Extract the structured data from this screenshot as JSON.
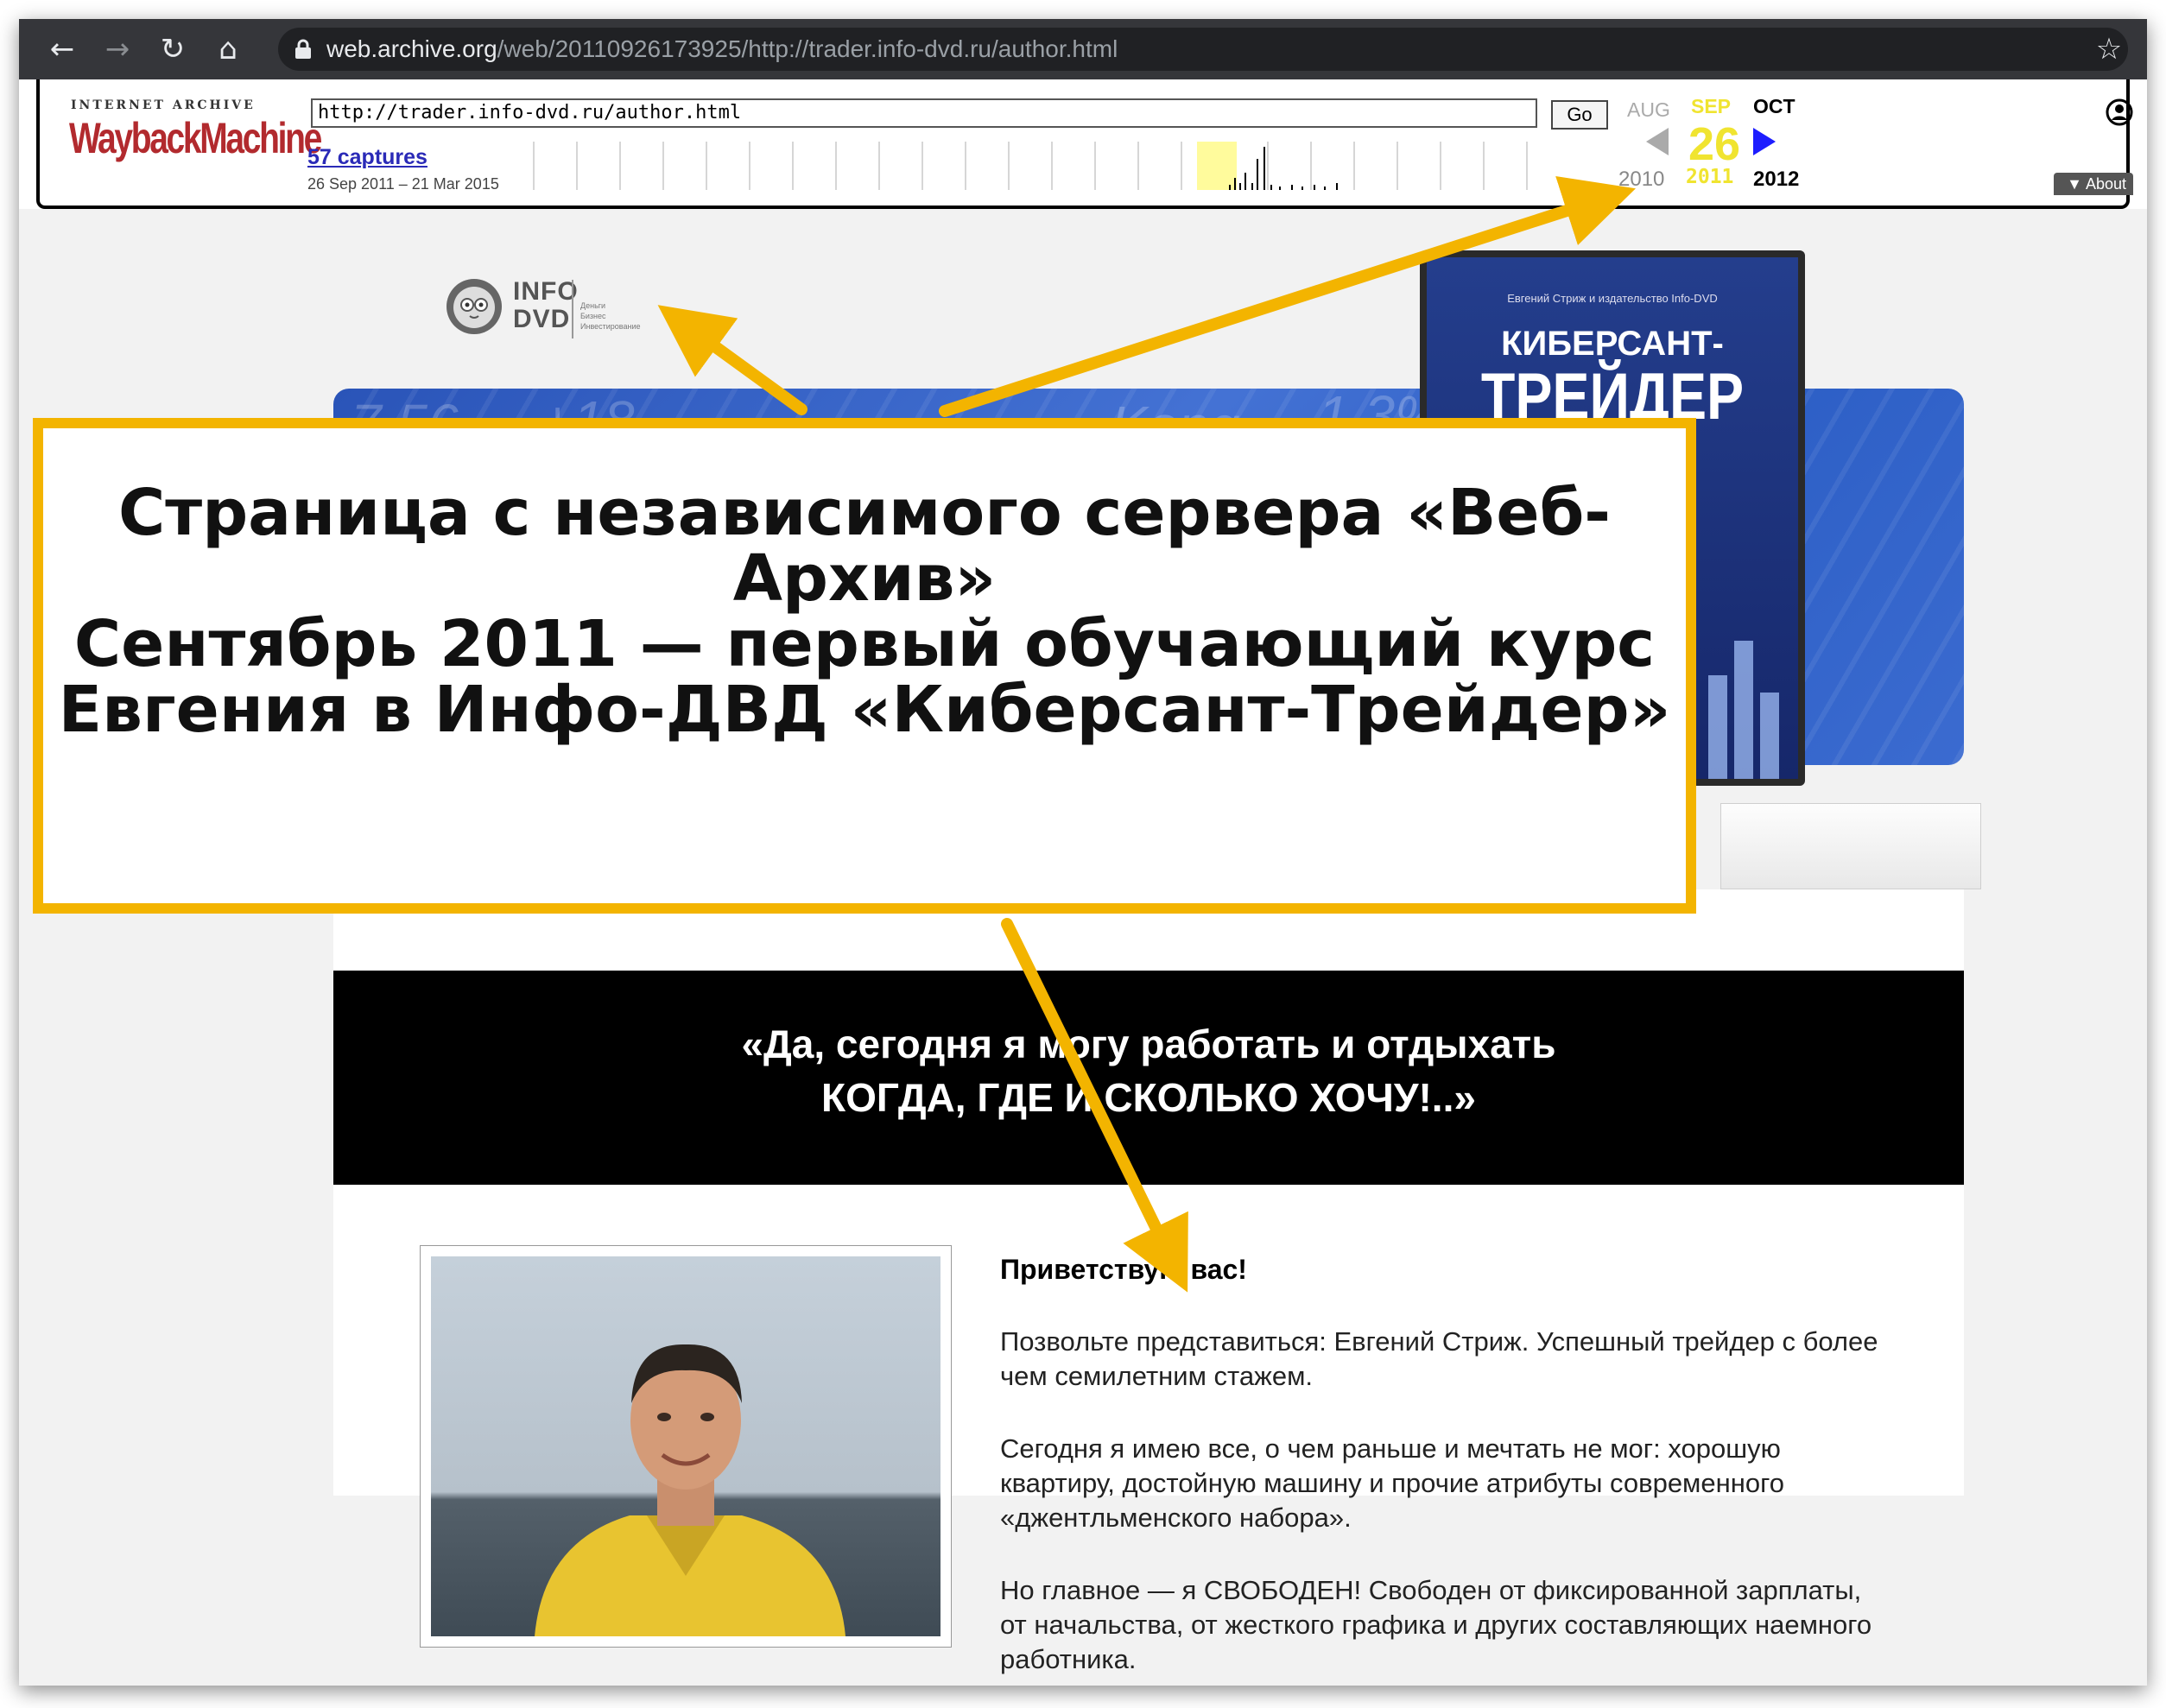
{
  "browser": {
    "url_host": "web.archive.org",
    "url_rest": "/web/20110926173925/http://trader.info-dvd.ru/author.html",
    "icons": [
      "back-arrow-icon",
      "forward-arrow-icon",
      "reload-icon",
      "home-icon",
      "lock-icon",
      "star-icon"
    ]
  },
  "wayback": {
    "internet_archive": "INTERNET ARCHIVE",
    "logo": "WaybackMachine",
    "url_value": "http://trader.info-dvd.ru/author.html",
    "go_label": "Go",
    "captures": "57 captures",
    "capture_range": "26 Sep 2011 – 21 Mar 2015",
    "month_prev": "AUG",
    "month_cur": "SEP",
    "month_next": "OCT",
    "day": "26",
    "year_prev": "2010",
    "year_cur": "2011",
    "year_next": "2012",
    "about_label": "About",
    "highlight_color": "#f0e430"
  },
  "site": {
    "logo_text_1": "INFO",
    "logo_text_2": "DVD",
    "logo_tagline_1": "Деньги",
    "logo_tagline_2": "Бизнес",
    "logo_tagline_3": "Инвестирование",
    "box_subtitle": "Евгений Стриж и издательство Info-DVD",
    "box_title_1": "КИБЕРСАНТ-",
    "box_title_2": "ТРЕЙДЕР",
    "banner_numbers": [
      "7.56",
      "+18",
      "Kong",
      "1.3%"
    ],
    "quote_line_1": "«Да, сегодня я могу работать и отдыхать",
    "quote_line_2": "КОГДА, ГДЕ И СКОЛЬКО ХОЧУ!..»",
    "greeting": "Приветствую вас!",
    "para_1": "Позвольте представиться: Евгений Стриж. Успешный трейдер с более чем семилетним стажем.",
    "para_2": "Сегодня я имею все, о чем раньше и мечтать не мог: хорошую квартиру, достойную машину и прочие атрибуты современного «джентльменского набора».",
    "para_3": "Но главное — я СВОБОДЕН! Свободен от фиксированной зарплаты, от начальства, от жесткого графика и других составляющих наемного работника."
  },
  "annotation": {
    "line_1": "Страница с независимого сервера «Веб-Архив»",
    "line_2": "Сентябрь 2011 — первый обучающий курс Евгения в Инфо-ДВД «Киберсант-Трейдер»",
    "border_color": "#f3b400"
  }
}
